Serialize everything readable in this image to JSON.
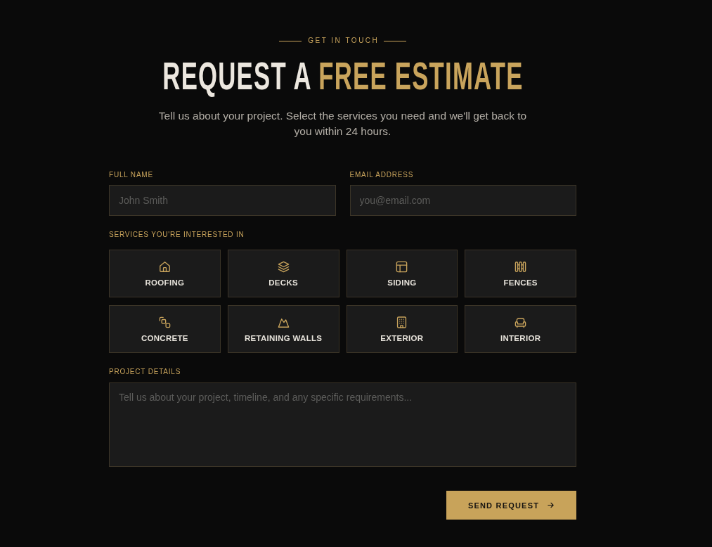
{
  "eyebrow": "GET IN TOUCH",
  "heading": {
    "text": "REQUEST A",
    "highlight": "FREE ESTIMATE"
  },
  "intro": "Tell us about your project. Select the services you need and we'll get back to you within 24 hours.",
  "fields": [
    {
      "label": "FULL NAME",
      "placeholder": "John Smith"
    },
    {
      "label": "EMAIL ADDRESS",
      "placeholder": "you@email.com"
    }
  ],
  "services": {
    "label": "SERVICES YOU'RE INTERESTED IN",
    "items": [
      {
        "label": "ROOFING",
        "selected": false
      },
      {
        "label": "DECKS",
        "selected": false
      },
      {
        "label": "SIDING",
        "selected": false
      },
      {
        "label": "FENCES",
        "selected": false
      },
      {
        "label": "CONCRETE",
        "selected": false
      },
      {
        "label": "RETAINING WALLS",
        "selected": false
      },
      {
        "label": "EXTERIOR",
        "selected": false
      },
      {
        "label": "INTERIOR",
        "selected": false
      }
    ]
  },
  "details": {
    "label": "PROJECT DETAILS",
    "placeholder": "Tell us about your project, timeline, and any specific requirements..."
  },
  "submit": {
    "label": "SEND REQUEST"
  }
}
